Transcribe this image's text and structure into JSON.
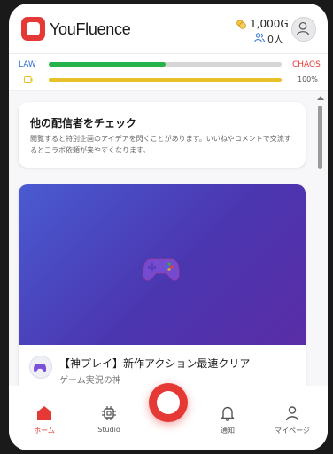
{
  "header": {
    "brand": "YouFluence",
    "coins": "1,000G",
    "users": "0人"
  },
  "meters": {
    "law_label": "LAW",
    "chaos_label": "CHAOS",
    "alignment_fraction": 0.5,
    "energy_fraction": 1.0,
    "energy_text": "100%"
  },
  "colors": {
    "accent": "#e53935",
    "law": "#2c6fd6",
    "alignment_bar": "#26b34a",
    "energy_bar": "#e8c12a"
  },
  "discover_card": {
    "title": "他の配信者をチェック",
    "description": "閲覧すると特別企画のアイデアを閃くことがあります。いいねやコメントで交流するとコラボ依頼が来やすくなります。"
  },
  "video_card": {
    "title": "【神プレイ】新作アクション最速クリア",
    "channel": "ゲーム実況の神",
    "thumbnail_icon": "gamepad-icon"
  },
  "nav": {
    "items": [
      {
        "label": "ホーム",
        "icon": "home-icon",
        "active": true
      },
      {
        "label": "Studio",
        "icon": "chip-icon",
        "active": false
      },
      {
        "label": "通知",
        "icon": "bell-icon",
        "active": false
      },
      {
        "label": "マイページ",
        "icon": "user-icon",
        "active": false
      }
    ],
    "center_icon": "record-icon"
  }
}
